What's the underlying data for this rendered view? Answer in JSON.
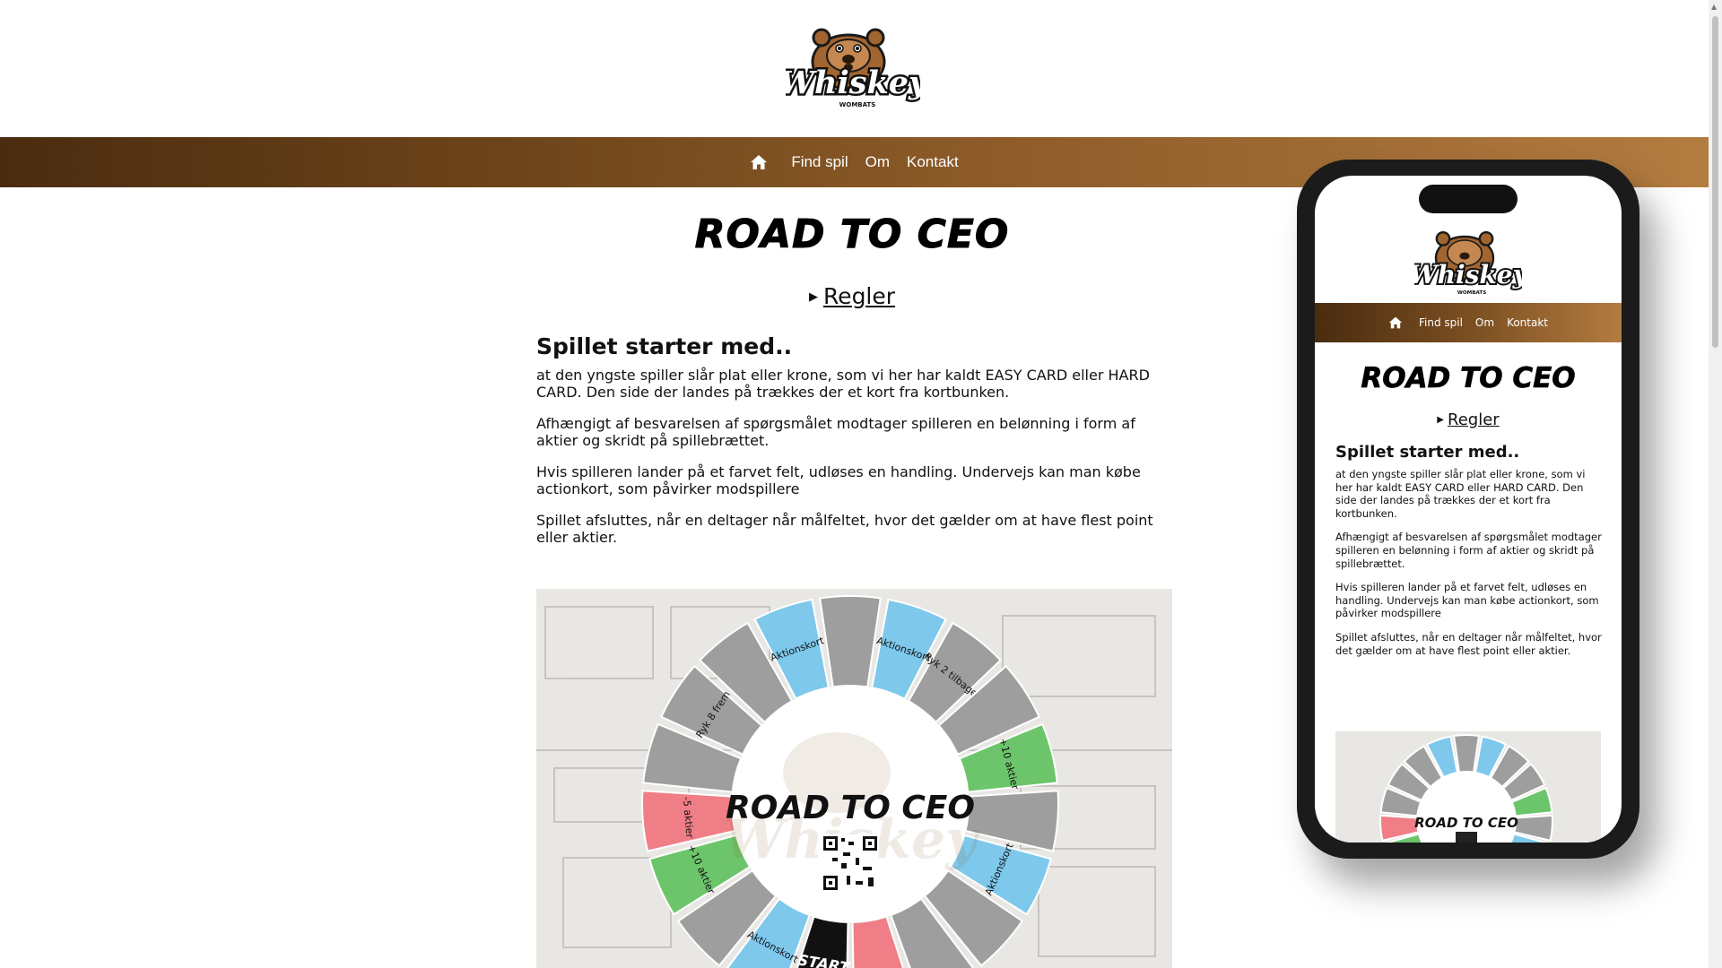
{
  "header": {
    "logo_text": "Whiskey",
    "logo_subtext": "WOMBATS"
  },
  "nav": {
    "home_icon": "home-icon",
    "items": [
      "Find spil",
      "Om",
      "Kontakt"
    ]
  },
  "main": {
    "title": "ROAD TO CEO",
    "rules_label": "Regler",
    "heading": "Spillet starter med..",
    "paragraphs": [
      "at den yngste spiller slår plat eller krone, som vi her har kaldt EASY CARD eller HARD CARD. Den side der landes på trækkes der et kort fra kortbunken.",
      "Afhængigt af besvarelsen af spørgsmålet modtager spilleren en belønning i form af aktier og skridt på spillebrættet.",
      "Hvis spilleren lander på et farvet felt, udløses en handling. Undervejs kan man købe actionkort, som påvirker modspillere",
      "Spillet afsluttes, når en deltager når målfeltet, hvor det gælder om at have flest point eller aktier."
    ]
  },
  "board": {
    "center_title": "ROAD TO CEO",
    "start_label": "START",
    "spaces": [
      {
        "label": "",
        "color": "#9e9e9e"
      },
      {
        "label": "Aktionskort",
        "color": "#7ec8ec"
      },
      {
        "label": "Ryk 2 tilbage",
        "color": "#9e9e9e"
      },
      {
        "label": "",
        "color": "#9e9e9e"
      },
      {
        "label": "+10 aktier",
        "color": "#6cc56b"
      },
      {
        "label": "",
        "color": "#9e9e9e"
      },
      {
        "label": "Aktionskort",
        "color": "#7ec8ec"
      },
      {
        "label": "",
        "color": "#9e9e9e"
      },
      {
        "label": "",
        "color": "#9e9e9e"
      },
      {
        "label": "",
        "color": "#ef7e86"
      },
      {
        "label": "START",
        "color": "#111111"
      },
      {
        "label": "Aktionskort",
        "color": "#7ec8ec"
      },
      {
        "label": "",
        "color": "#9e9e9e"
      },
      {
        "label": "+10 aktier",
        "color": "#6cc56b"
      },
      {
        "label": "-5 aktier",
        "color": "#ef7e86"
      },
      {
        "label": "",
        "color": "#9e9e9e"
      },
      {
        "label": "Ryk 8 frem",
        "color": "#9e9e9e"
      },
      {
        "label": "",
        "color": "#9e9e9e"
      },
      {
        "label": "Aktionskort",
        "color": "#7ec8ec"
      }
    ]
  },
  "phone": {
    "nav_items": [
      "Find spil",
      "Om",
      "Kontakt"
    ],
    "title": "ROAD TO CEO",
    "rules_label": "Regler",
    "heading": "Spillet starter med.."
  },
  "colors": {
    "nav_start": "#4a2c10",
    "nav_end": "#b37c40",
    "aktion": "#7ec8ec",
    "plus": "#6cc56b",
    "minus": "#ef7e86",
    "neutral": "#9e9e9e"
  }
}
